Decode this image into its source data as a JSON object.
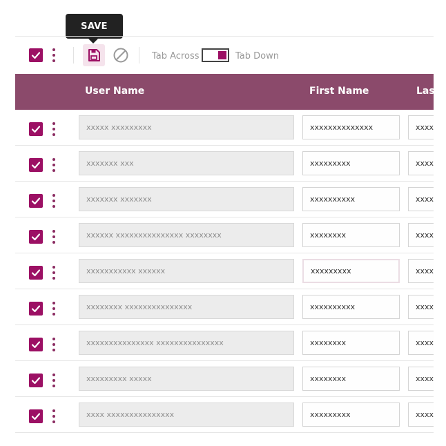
{
  "tooltip": {
    "label": "SAVE"
  },
  "toolbar": {
    "tab_across_label": "Tab Across",
    "tab_down_label": "Tab Down",
    "toggle_state": "tab-down",
    "icons": [
      "check-icon",
      "kebab-menu-icon",
      "save-icon",
      "cancel-icon"
    ]
  },
  "colors": {
    "accent": "#9c1064",
    "header_bg": "#8b4a6b",
    "readonly_cell_bg": "#ececec",
    "tooltip_bg": "#222222"
  },
  "grid": {
    "columns": [
      "User Name",
      "First Name",
      "Last"
    ],
    "rows": [
      {
        "user_name": "xxxxx xxxxxxxxx",
        "first_name": "xxxxxxxxxxxxxx",
        "last_name": "xxxxxxxx"
      },
      {
        "user_name": "xxxxxxx xxx",
        "first_name": "xxxxxxxxx",
        "last_name": "xxxxxxxx"
      },
      {
        "user_name": "xxxxxxx xxxxxxx",
        "first_name": "xxxxxxxxxx",
        "last_name": "xxxxxxxx"
      },
      {
        "user_name": "xxxxxx xxxxxxxxxxxxxxx xxxxxxxx",
        "first_name": "xxxxxxxx",
        "last_name": "xxxxxxxx"
      },
      {
        "user_name": "xxxxxxxxxxx xxxxxx",
        "first_name": "xxxxxxxxx",
        "last_name": "xxxxxxxx"
      },
      {
        "user_name": "xxxxxxxx xxxxxxxxxxxxxxx",
        "first_name": "xxxxxxxxxx",
        "last_name": "xxxxxxxx"
      },
      {
        "user_name": "xxxxxxxxxxxxxxx xxxxxxxxxxxxxxx",
        "first_name": "xxxxxxxx",
        "last_name": "xxxxxxxx"
      },
      {
        "user_name": "xxxxxxxxx xxxxx",
        "first_name": "xxxxxxxx",
        "last_name": "xxxxxxxx"
      },
      {
        "user_name": "xxxx xxxxxxxxxxxxxxx",
        "first_name": "xxxxxxxxx",
        "last_name": "xxxxxxxx"
      }
    ]
  }
}
